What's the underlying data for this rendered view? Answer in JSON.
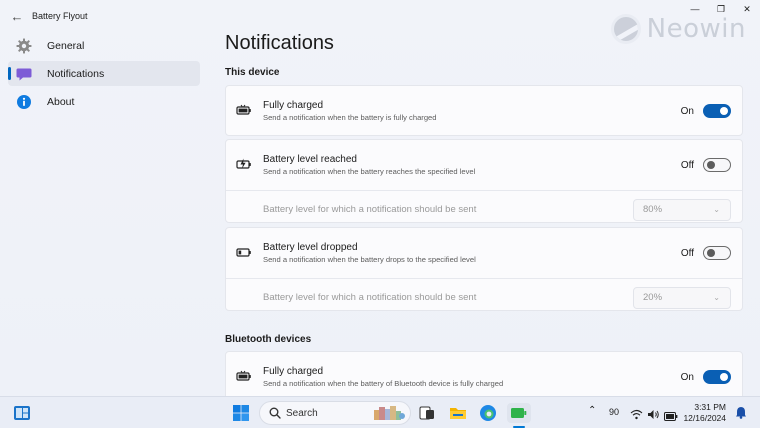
{
  "window": {
    "app_title": "Battery Flyout",
    "minimize_glyph": "—",
    "maximize_glyph": "❐",
    "close_glyph": "✕",
    "back_glyph": "←"
  },
  "watermark": {
    "text": "Neowin"
  },
  "sidebar": {
    "items": [
      {
        "label": "General",
        "icon": "gear-icon",
        "selected": false
      },
      {
        "label": "Notifications",
        "icon": "chat-icon",
        "selected": true
      },
      {
        "label": "About",
        "icon": "info-icon",
        "selected": false
      }
    ]
  },
  "main": {
    "page_title": "Notifications",
    "sections": {
      "this_device": {
        "title": "This device",
        "fully_charged": {
          "title": "Fully charged",
          "description": "Send a notification when the battery is fully charged",
          "state": "On"
        },
        "level_reached": {
          "title": "Battery level reached",
          "description": "Send a notification when the battery reaches the specified level",
          "state": "Off",
          "sub_label": "Battery level for which a notification should be sent",
          "sub_value": "80%"
        },
        "level_dropped": {
          "title": "Battery level dropped",
          "description": "Send a notification when the battery drops to the specified level",
          "state": "Off",
          "sub_label": "Battery level for which a notification should be sent",
          "sub_value": "20%"
        }
      },
      "bluetooth": {
        "title": "Bluetooth devices",
        "fully_charged": {
          "title": "Fully charged",
          "description": "Send a notification when the battery of Bluetooth device is fully charged",
          "state": "On"
        }
      }
    }
  },
  "taskbar": {
    "search_label": "Search",
    "battery_percent": "90",
    "time": "3:31 PM",
    "date": "12/16/2024",
    "colors": {
      "accent": "#0a5fb4",
      "windows_blue": "#0078d4"
    }
  }
}
